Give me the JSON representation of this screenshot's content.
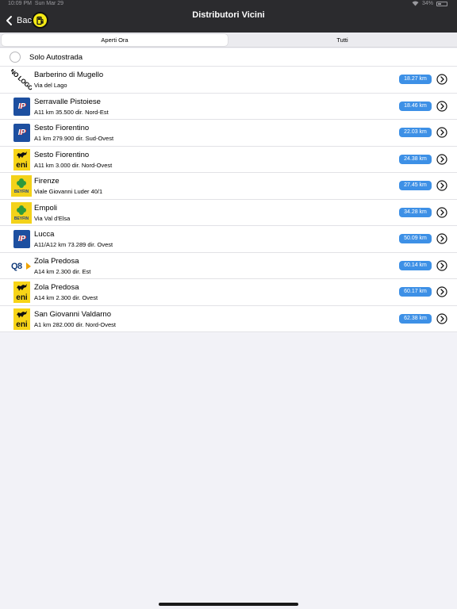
{
  "status_bar": {
    "time": "10:09 PM",
    "date": "Sun Mar 29",
    "battery": "34%"
  },
  "header": {
    "back_label": "Back",
    "title": "Distributori Vicini"
  },
  "tabs": [
    {
      "label": "Aperti Ora",
      "selected": true
    },
    {
      "label": "Tutti",
      "selected": false
    }
  ],
  "filter": {
    "label": "Solo Autostrada",
    "checked": false
  },
  "stations": [
    {
      "name": "Barberino di Mugello",
      "address": "Via del Lago",
      "distance": "18.27 km",
      "brand": "nologo",
      "logo_text": "NO LOGO"
    },
    {
      "name": "Serravalle Pistoiese",
      "address": "A11 km 35.500 dir. Nord-Est",
      "distance": "18.46 km",
      "brand": "ip",
      "logo_text": "IP"
    },
    {
      "name": "Sesto Fiorentino",
      "address": "A1 km 279.900 dir. Sud-Ovest",
      "distance": "22.03 km",
      "brand": "ip",
      "logo_text": "IP"
    },
    {
      "name": "Sesto Fiorentino",
      "address": "A11 km 3.000 dir. Nord-Ovest",
      "distance": "24.38 km",
      "brand": "eni",
      "logo_text": "eni"
    },
    {
      "name": "Firenze",
      "address": "Viale Giovanni Luder 40/1",
      "distance": "27.45 km",
      "brand": "beyfin",
      "logo_text": "BEYFIN"
    },
    {
      "name": "Empoli",
      "address": "Via Val d'Elsa",
      "distance": "34.28 km",
      "brand": "beyfin",
      "logo_text": "BEYFIN"
    },
    {
      "name": "Lucca",
      "address": "A11/A12 km 73.289 dir. Ovest",
      "distance": "50.09 km",
      "brand": "ip",
      "logo_text": "IP"
    },
    {
      "name": "Zola Predosa",
      "address": "A14 km 2.300 dir. Est",
      "distance": "60.14 km",
      "brand": "q8",
      "logo_text": "Q8"
    },
    {
      "name": "Zola Predosa",
      "address": "A14 km 2.300 dir. Ovest",
      "distance": "60.17 km",
      "brand": "eni",
      "logo_text": "eni"
    },
    {
      "name": "San Giovanni Valdarno",
      "address": "A1 km 282.000 dir. Nord-Ovest",
      "distance": "62.38 km",
      "brand": "eni",
      "logo_text": "eni"
    }
  ],
  "icons": {
    "back": "chevron-left-icon",
    "fuel": "fuel-pump-icon",
    "detail": "chevron-right-circle-icon",
    "wifi": "wifi-icon",
    "battery": "battery-icon"
  },
  "colors": {
    "header_bg": "#2b2b2e",
    "distance_badge": "#3d90e6",
    "pump_button": "#f5ea15",
    "page_bg": "#f2f2f7"
  }
}
